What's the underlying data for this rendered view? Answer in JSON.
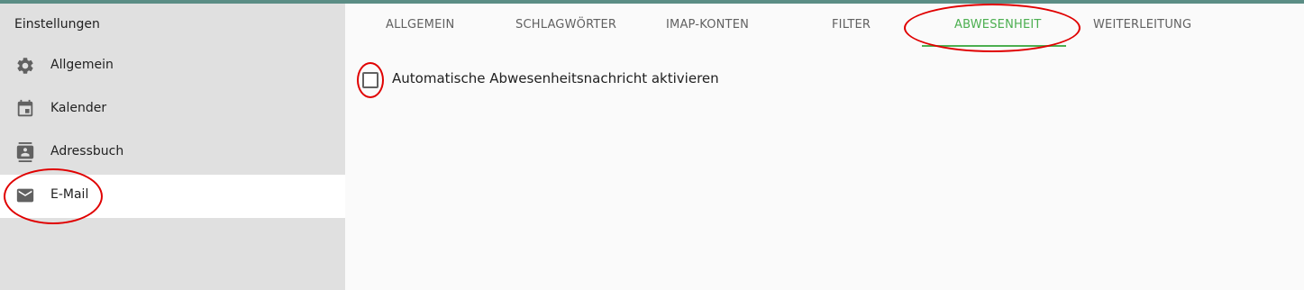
{
  "sidebar": {
    "title": "Einstellungen",
    "items": [
      {
        "label": "Allgemein",
        "icon": "gear-icon"
      },
      {
        "label": "Kalender",
        "icon": "calendar-icon"
      },
      {
        "label": "Adressbuch",
        "icon": "contact-book-icon"
      },
      {
        "label": "E-Mail",
        "icon": "envelope-icon",
        "active": true
      }
    ]
  },
  "tabs": [
    {
      "label": "ALLGEMEIN"
    },
    {
      "label": "SCHLAGWÖRTER"
    },
    {
      "label": "IMAP-KONTEN"
    },
    {
      "label": "FILTER"
    },
    {
      "label": "ABWESENHEIT",
      "active": true
    },
    {
      "label": "WEITERLEITUNG"
    }
  ],
  "absence": {
    "checkbox_label": "Automatische Abwesenheitsnachricht aktivieren",
    "checked": false
  },
  "colors": {
    "accent": "#4caf50",
    "topbar": "#5b8d85",
    "sidebar_bg": "#e0e0e0",
    "annotation": "#e00000"
  }
}
